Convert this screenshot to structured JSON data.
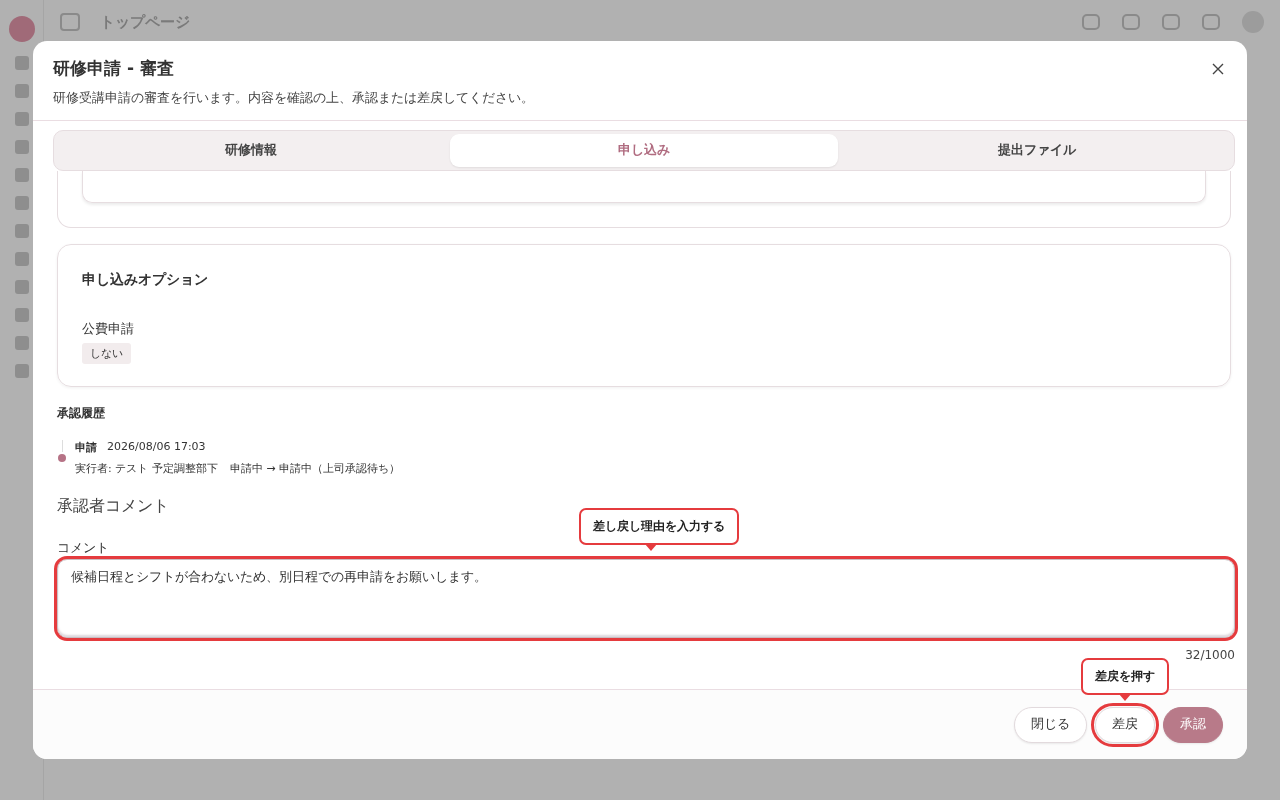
{
  "background": {
    "page_title": "トップページ"
  },
  "dialog": {
    "title": "研修申請 - 審査",
    "description": "研修受講申請の審査を行います。内容を確認の上、承認または差戻してください。",
    "tabs": [
      {
        "label": "研修情報",
        "selected": false
      },
      {
        "label": "申し込み",
        "selected": true
      },
      {
        "label": "提出ファイル",
        "selected": false
      }
    ],
    "options_card": {
      "title": "申し込みオプション",
      "fields": [
        {
          "label": "公費申請",
          "value": "しない"
        }
      ]
    },
    "history": {
      "title": "承認履歴",
      "entries": [
        {
          "action": "申請",
          "datetime": "2026/08/06 17:03",
          "executor": "実行者: テスト 予定調整部下",
          "transition": "申請中 → 申請中（上司承認待ち）"
        }
      ]
    },
    "comment_section": {
      "title": "承認者コメント",
      "label": "コメント",
      "value": "候補日程とシフトが合わないため、別日程での再申請をお願いします。",
      "counter": "32/1000",
      "highlighted": true,
      "callout": "差し戻し理由を入力する"
    },
    "buttons": [
      {
        "label": "閉じる",
        "kind": "secondary",
        "highlighted": false
      },
      {
        "label": "差戻",
        "kind": "secondary",
        "highlighted": true,
        "callout": "差戻を押す"
      },
      {
        "label": "承認",
        "kind": "primary",
        "highlighted": false
      }
    ]
  }
}
